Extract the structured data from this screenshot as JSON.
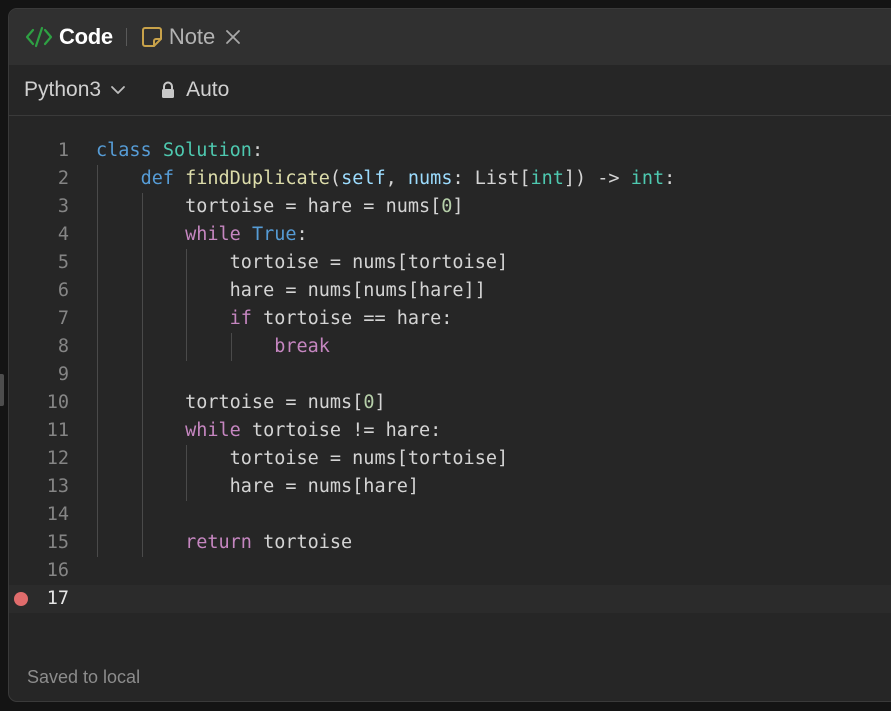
{
  "tabs": {
    "code_label": "Code",
    "note_label": "Note"
  },
  "toolbar": {
    "language": "Python3",
    "mode": "Auto"
  },
  "editor": {
    "active_line": 17,
    "breakpoint_line": 17,
    "lines": [
      [
        [
          "kw",
          "class"
        ],
        [
          "id",
          " "
        ],
        [
          "cls",
          "Solution"
        ],
        [
          "punc",
          ":"
        ]
      ],
      [
        [
          "id",
          "    "
        ],
        [
          "kw",
          "def"
        ],
        [
          "id",
          " "
        ],
        [
          "fn",
          "findDuplicate"
        ],
        [
          "punc",
          "("
        ],
        [
          "self",
          "self"
        ],
        [
          "punc",
          ", "
        ],
        [
          "param",
          "nums"
        ],
        [
          "punc",
          ": "
        ],
        [
          "id",
          "List"
        ],
        [
          "punc",
          "["
        ],
        [
          "type",
          "int"
        ],
        [
          "punc",
          "]) -> "
        ],
        [
          "type",
          "int"
        ],
        [
          "punc",
          ":"
        ]
      ],
      [
        [
          "id",
          "        tortoise = hare = nums["
        ],
        [
          "num",
          "0"
        ],
        [
          "punc",
          "]"
        ]
      ],
      [
        [
          "id",
          "        "
        ],
        [
          "ctl",
          "while"
        ],
        [
          "id",
          " "
        ],
        [
          "kw",
          "True"
        ],
        [
          "punc",
          ":"
        ]
      ],
      [
        [
          "id",
          "            tortoise = nums[tortoise]"
        ]
      ],
      [
        [
          "id",
          "            hare = nums[nums[hare]]"
        ]
      ],
      [
        [
          "id",
          "            "
        ],
        [
          "ctl",
          "if"
        ],
        [
          "id",
          " tortoise == hare:"
        ]
      ],
      [
        [
          "id",
          "                "
        ],
        [
          "ctl",
          "break"
        ]
      ],
      [],
      [
        [
          "id",
          "        tortoise = nums["
        ],
        [
          "num",
          "0"
        ],
        [
          "punc",
          "]"
        ]
      ],
      [
        [
          "id",
          "        "
        ],
        [
          "ctl",
          "while"
        ],
        [
          "id",
          " tortoise != hare:"
        ]
      ],
      [
        [
          "id",
          "            tortoise = nums[tortoise]"
        ]
      ],
      [
        [
          "id",
          "            hare = nums[hare]"
        ]
      ],
      [],
      [
        [
          "id",
          "        "
        ],
        [
          "ctl",
          "return"
        ],
        [
          "id",
          " tortoise"
        ]
      ],
      [],
      []
    ]
  },
  "status": {
    "text": "Saved to local"
  },
  "colors": {
    "accent_green": "#2ea043",
    "note_icon": "#c8a24a",
    "breakpoint": "#e06c6c"
  },
  "icons": {
    "code_tab": "code-brackets-icon",
    "note_tab": "note-icon",
    "close": "close-icon",
    "language_dropdown": "chevron-down-icon",
    "mode": "lock-icon"
  }
}
